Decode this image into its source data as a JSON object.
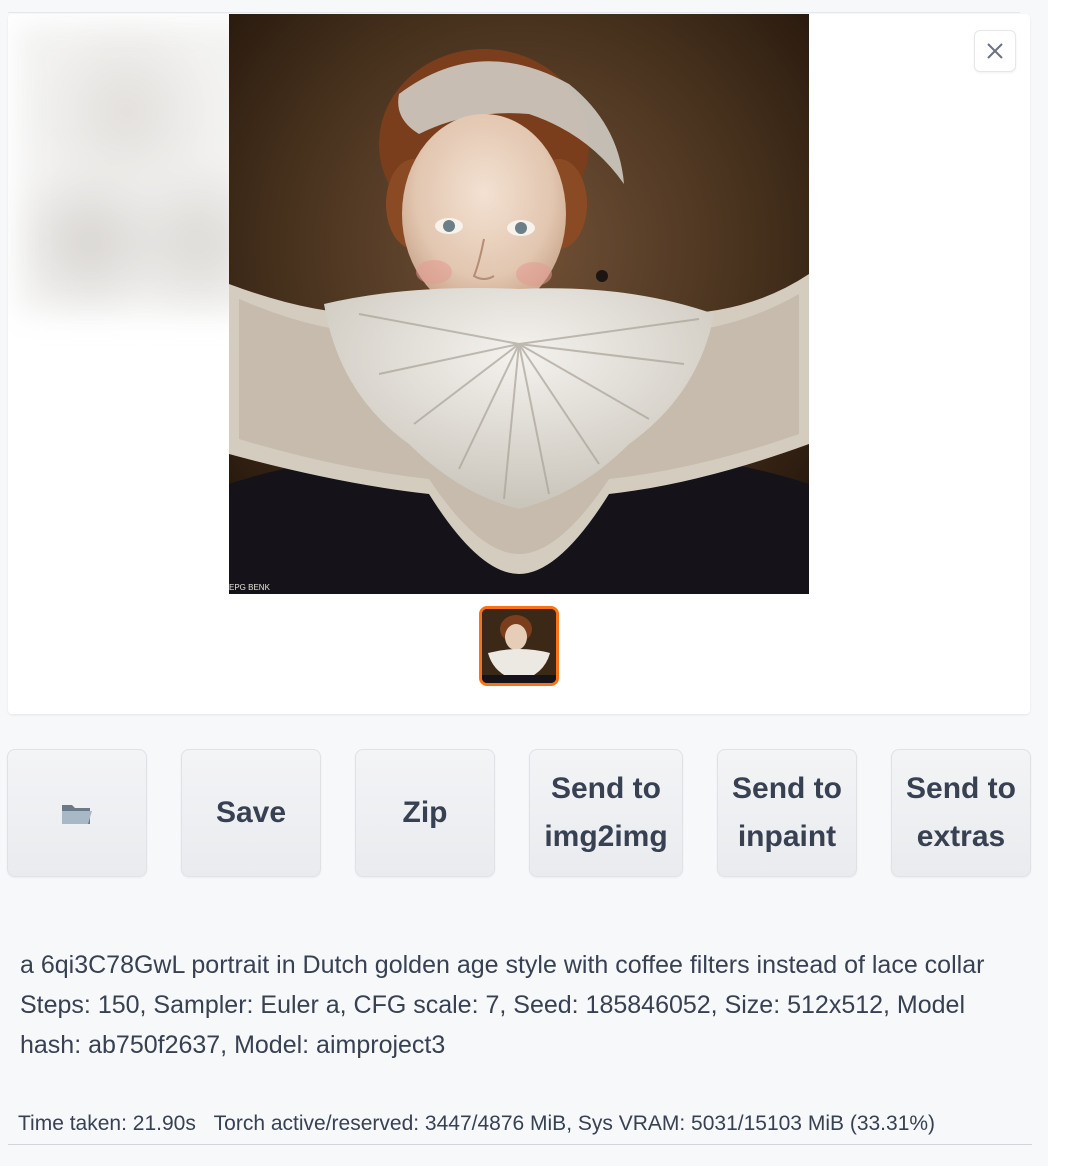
{
  "gallery": {
    "close_label": "close",
    "watermark": "EPG BENK",
    "main_image_alt": "portrait",
    "thumbnail_alt": "portrait thumbnail"
  },
  "buttons": {
    "folder_icon": "folder-icon",
    "save_label": "Save",
    "zip_label": "Zip",
    "send_img2img_line1": "Send to",
    "send_img2img_line2": "img2img",
    "send_inpaint_line1": "Send to",
    "send_inpaint_line2": "inpaint",
    "send_extras_line1": "Send to",
    "send_extras_line2": "extras"
  },
  "generation_info": {
    "prompt": "a 6qi3C78GwL portrait in Dutch golden age style with coffee filters instead of lace collar",
    "params": "Steps: 150, Sampler: Euler a, CFG scale: 7, Seed: 185846052, Size: 512x512, Model hash: ab750f2637, Model: aimproject3"
  },
  "timing": {
    "time_taken": "Time taken: 21.90s",
    "torch": "Torch active/reserved: 3447/4876 MiB, Sys VRAM: 5031/15103 MiB (33.31%)"
  },
  "colors": {
    "accent_orange": "#f97316",
    "button_bg": "#f3f4f6",
    "text": "#374151"
  }
}
